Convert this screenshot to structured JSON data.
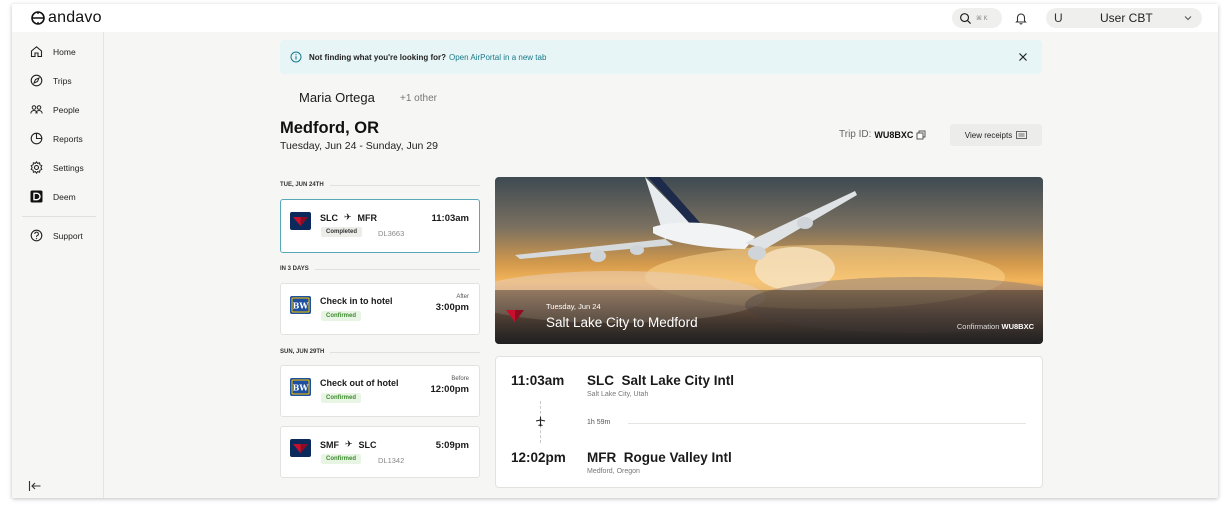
{
  "app": {
    "logo_text": "andavo"
  },
  "topbar": {
    "search_shortcut": "⌘ K",
    "user_initial": "U",
    "user_name": "User CBT"
  },
  "sidebar": {
    "items": [
      {
        "label": "Home",
        "icon": "home-icon"
      },
      {
        "label": "Trips",
        "icon": "compass-icon"
      },
      {
        "label": "People",
        "icon": "people-icon"
      },
      {
        "label": "Reports",
        "icon": "pie-chart-icon"
      },
      {
        "label": "Settings",
        "icon": "gear-icon"
      },
      {
        "label": "Deem",
        "icon": "deem-logo-icon"
      }
    ],
    "support_label": "Support"
  },
  "banner": {
    "message": "Not finding what you're looking for?",
    "link_text": "Open AirPortal in a new tab"
  },
  "trip": {
    "traveler": "Maria Ortega",
    "others": "+1 other",
    "city": "Medford, OR",
    "dates": "Tuesday, Jun 24 - Sunday, Jun 29",
    "trip_id_label": "Trip ID:",
    "trip_id": "WU8BXC",
    "receipts_label": "View receipts"
  },
  "timeline": {
    "sections": [
      {
        "label": "TUE, JUN 24TH"
      },
      {
        "label": "IN 3 DAYS"
      },
      {
        "label": "SUN, JUN 29TH"
      }
    ],
    "cards": [
      {
        "title_from": "SLC",
        "title_to": "MFR",
        "status": "Completed",
        "flight": "DL3663",
        "time": "11:03am",
        "time_sub": ""
      },
      {
        "title": "Check in to hotel",
        "status": "Confirmed",
        "time": "3:00pm",
        "time_sub": "After"
      },
      {
        "title": "Check out of hotel",
        "status": "Confirmed",
        "time": "12:00pm",
        "time_sub": "Before"
      },
      {
        "title_from": "SMF",
        "title_to": "SLC",
        "status": "Confirmed",
        "flight": "DL1342",
        "time": "5:09pm",
        "time_sub": ""
      }
    ]
  },
  "hero": {
    "date": "Tuesday, Jun 24",
    "route": "Salt Lake City to Medford",
    "confirmation_label": "Confirmation",
    "confirmation_code": "WU8BXC"
  },
  "flight_details": {
    "depart_time": "11:03am",
    "depart_airport": "SLC  Salt Lake City Intl",
    "depart_city": "Salt Lake City, Utah",
    "duration": "1h 59m",
    "arrive_time": "12:02pm",
    "arrive_airport": "MFR  Rogue Valley Intl",
    "arrive_city": "Medford, Oregon"
  },
  "colors": {
    "accent": "#1a7a8a",
    "delta_red": "#c8102e",
    "delta_navy": "#0b2a5b",
    "bw_blue": "#1f4fa0",
    "confirmed_green": "#3c8a2e"
  }
}
